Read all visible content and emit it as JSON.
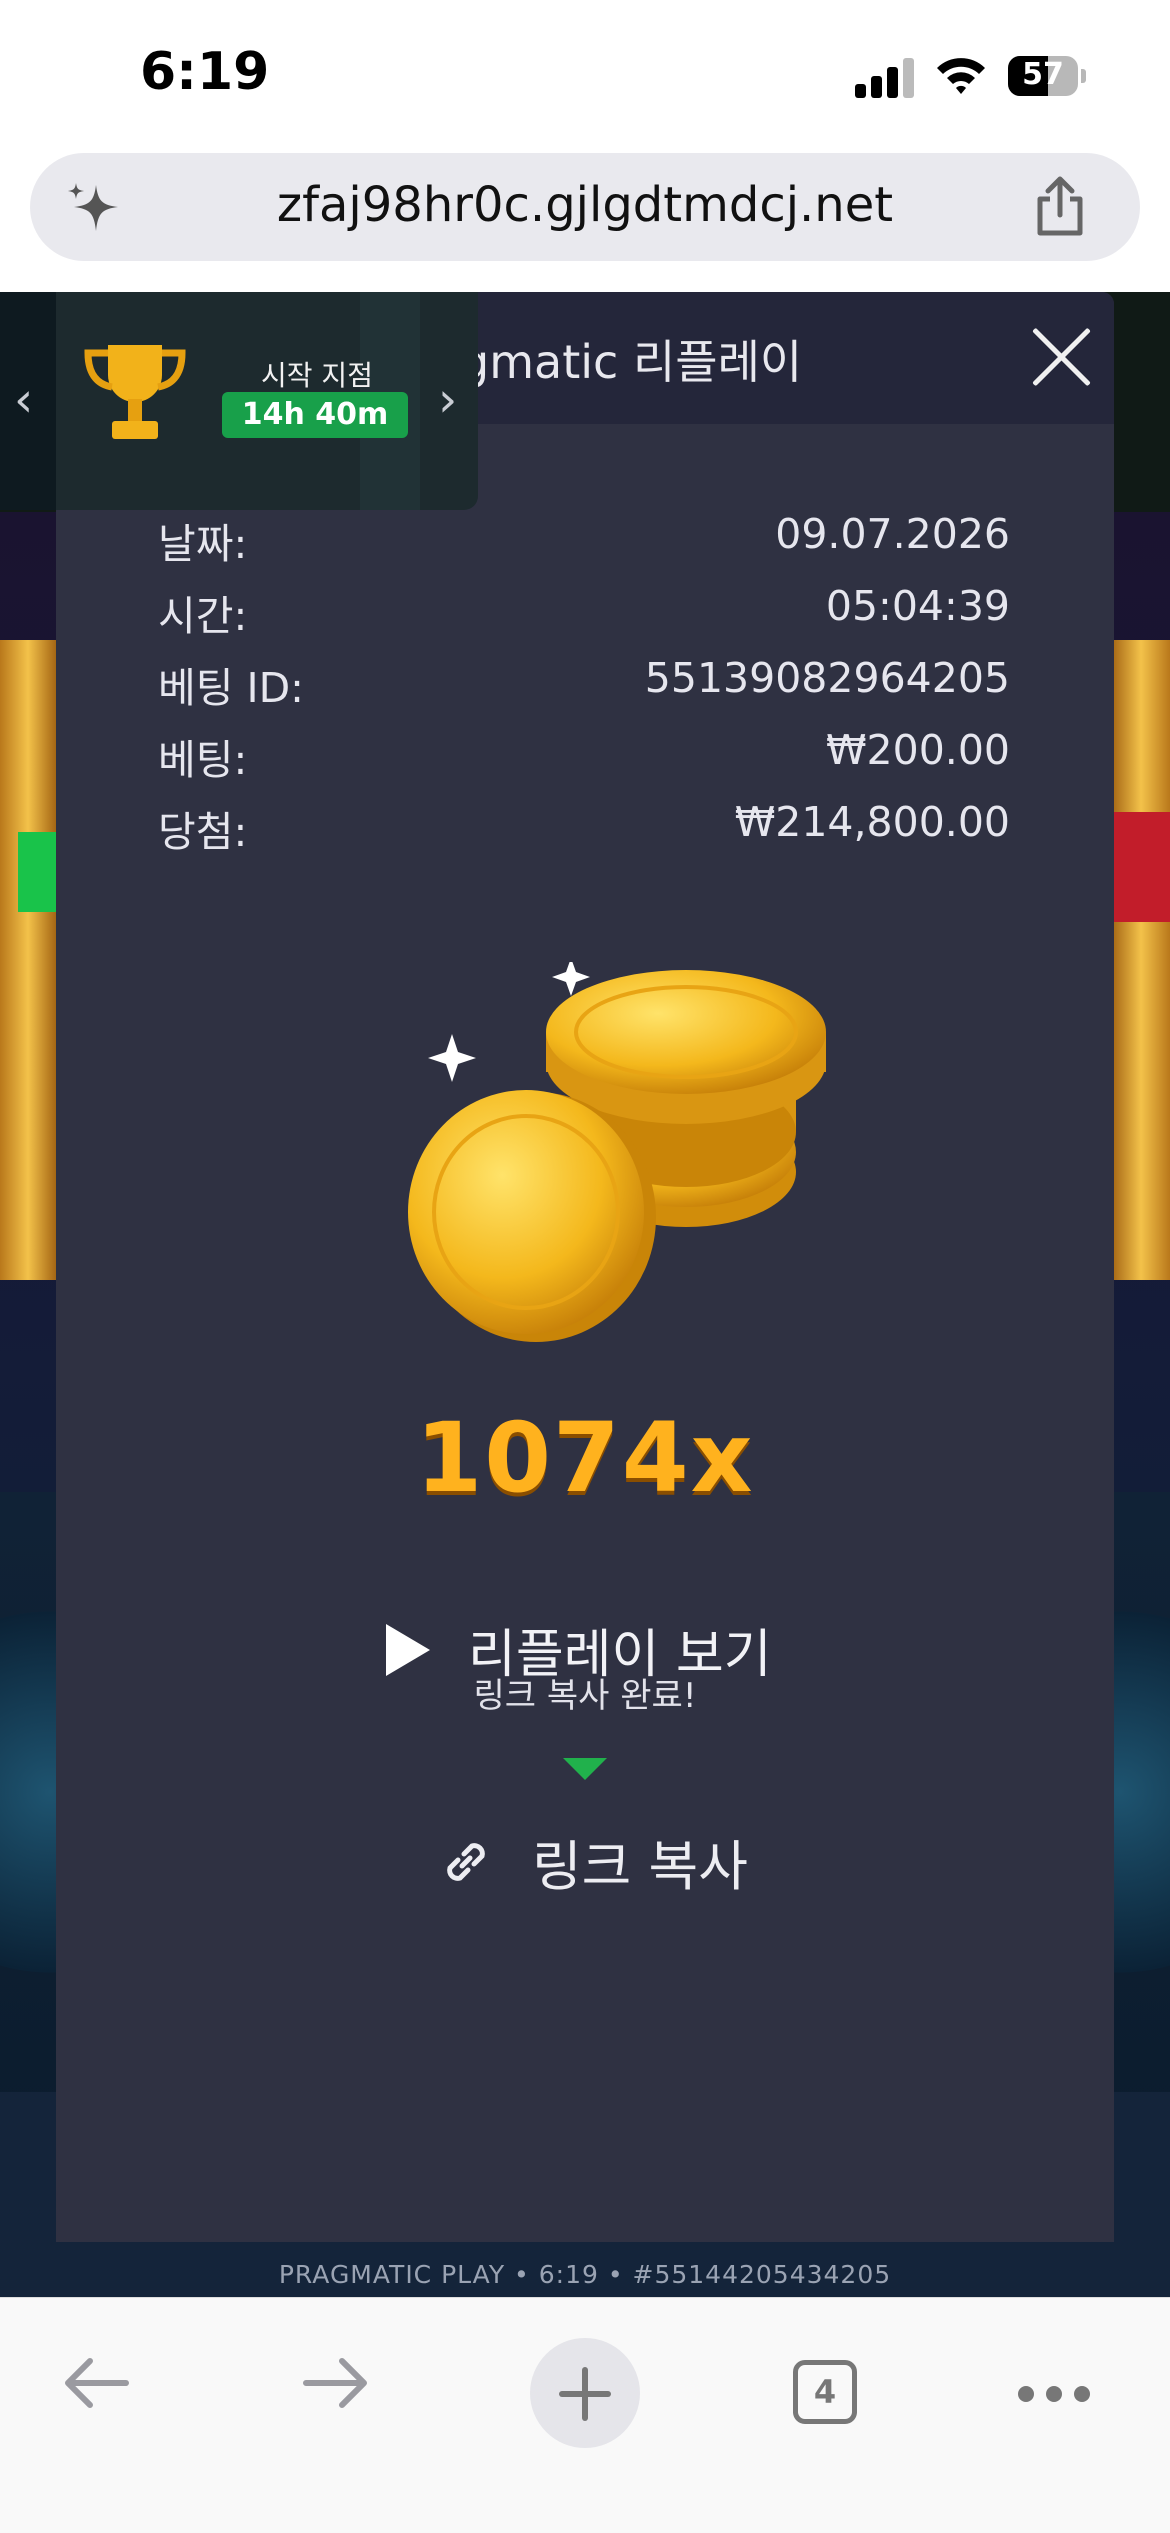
{
  "status_bar": {
    "time": "6:19",
    "battery_level": "57",
    "battery_fraction": 0.57
  },
  "browser": {
    "url": "zfaj98hr0c.gjlgdtmdcj.net",
    "tab_count": "4"
  },
  "tournament": {
    "label": "시작 지점",
    "timer": "14h 40m"
  },
  "dialog": {
    "title": "Pragmatic 리플레이",
    "rows": [
      {
        "label": "날짜:",
        "value": "09.07.2026"
      },
      {
        "label": "시간:",
        "value": "05:04:39"
      },
      {
        "label": "베팅 ID:",
        "value": "55139082964205"
      },
      {
        "label": "베팅:",
        "value": "₩200.00"
      },
      {
        "label": "당첨:",
        "value": "₩214,800.00"
      }
    ],
    "multiplier": "1074x",
    "replay_label": "리플레이 보기",
    "copied_tip": "링크 복사 완료!",
    "copy_link_label": "링크 복사"
  },
  "game": {
    "footer": "PRAGMATIC PLAY • 6:19 • #55144205434205"
  },
  "colors": {
    "accent_green": "#18a04a",
    "multiplier_gold": "#ffb21e",
    "dialog_bg": "#2f3142"
  }
}
